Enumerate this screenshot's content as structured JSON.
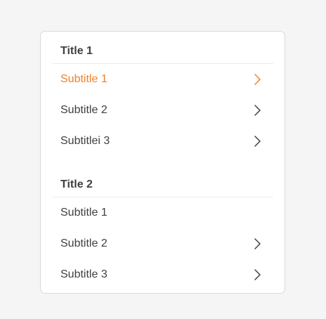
{
  "colors": {
    "accent": "#f07f2a",
    "text": "#3f3f3f",
    "background": "#f5f5f5",
    "card": "#ffffff"
  },
  "groups": [
    {
      "title": "Title 1",
      "items": [
        {
          "label": "Subtitle 1",
          "active": true,
          "icon": "chevron-right-icon"
        },
        {
          "label": "Subtitle 2",
          "active": false,
          "icon": "chevron-right-icon"
        },
        {
          "label": "Subtitlei 3",
          "active": false,
          "icon": "chevron-right-icon"
        }
      ]
    },
    {
      "title": "Title 2",
      "items": [
        {
          "label": "Subtitle 1",
          "active": false,
          "icon": ""
        },
        {
          "label": "Subtitle 2",
          "active": false,
          "icon": "chevron-right-icon"
        },
        {
          "label": "Subtitle 3",
          "active": false,
          "icon": "chevron-right-icon"
        }
      ]
    }
  ]
}
